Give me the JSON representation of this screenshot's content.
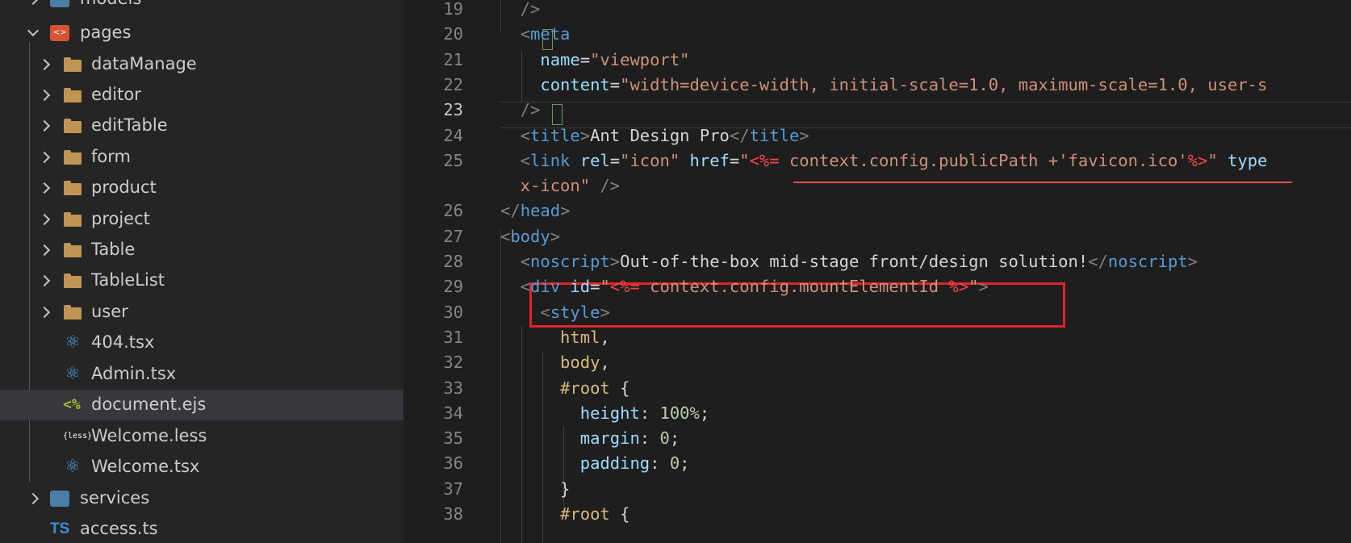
{
  "explorer": {
    "items": [
      {
        "label": "models",
        "kind": "folder-special",
        "icon": "models-folder-icon",
        "expanded": false
      },
      {
        "label": "pages",
        "kind": "folder-special",
        "icon": "pages-folder-icon",
        "expanded": true
      },
      {
        "label": "dataManage",
        "kind": "folder",
        "icon": "folder-icon"
      },
      {
        "label": "editor",
        "kind": "folder",
        "icon": "folder-icon"
      },
      {
        "label": "editTable",
        "kind": "folder",
        "icon": "folder-icon"
      },
      {
        "label": "form",
        "kind": "folder",
        "icon": "folder-icon"
      },
      {
        "label": "product",
        "kind": "folder",
        "icon": "folder-icon"
      },
      {
        "label": "project",
        "kind": "folder",
        "icon": "folder-icon"
      },
      {
        "label": "Table",
        "kind": "folder",
        "icon": "folder-icon"
      },
      {
        "label": "TableList",
        "kind": "folder",
        "icon": "folder-icon"
      },
      {
        "label": "user",
        "kind": "folder",
        "icon": "folder-icon"
      },
      {
        "label": "404.tsx",
        "kind": "file",
        "icon": "react-icon"
      },
      {
        "label": "Admin.tsx",
        "kind": "file",
        "icon": "react-icon"
      },
      {
        "label": "document.ejs",
        "kind": "file",
        "icon": "ejs-icon",
        "selected": true
      },
      {
        "label": "Welcome.less",
        "kind": "file",
        "icon": "less-icon"
      },
      {
        "label": "Welcome.tsx",
        "kind": "file",
        "icon": "react-icon"
      },
      {
        "label": "services",
        "kind": "folder-special",
        "icon": "services-folder-icon",
        "expanded": false
      },
      {
        "label": "access.ts",
        "kind": "file",
        "icon": "ts-icon"
      }
    ],
    "icon_glyphs": {
      "react": "⚛",
      "ejs": "<%",
      "less": "{less}",
      "ts": "TS",
      "pages": "<>"
    }
  },
  "editor": {
    "active_line": "23",
    "lines": [
      {
        "n": "19",
        "parts": [
          [
            "t-br",
            "  />"
          ]
        ]
      },
      {
        "n": "20",
        "parts": [
          [
            "t-br",
            "  <"
          ],
          [
            "t-tag",
            "meta"
          ]
        ]
      },
      {
        "n": "21",
        "parts": [
          [
            "t-attr",
            "    name"
          ],
          [
            "t-txt",
            "="
          ],
          [
            "t-str",
            "\"viewport\""
          ]
        ]
      },
      {
        "n": "22",
        "parts": [
          [
            "t-attr",
            "    content"
          ],
          [
            "t-txt",
            "="
          ],
          [
            "t-str",
            "\"width=device-width, initial-scale=1.0, maximum-scale=1.0, user-s"
          ]
        ]
      },
      {
        "n": "23",
        "parts": [
          [
            "t-br",
            "  />"
          ]
        ]
      },
      {
        "n": "24",
        "parts": [
          [
            "t-br",
            "  <"
          ],
          [
            "t-tag",
            "title"
          ],
          [
            "t-br",
            ">"
          ],
          [
            "t-txt",
            "Ant Design Pro"
          ],
          [
            "t-br",
            "</"
          ],
          [
            "t-tag",
            "title"
          ],
          [
            "t-br",
            ">"
          ]
        ]
      },
      {
        "n": "25",
        "parts": [
          [
            "t-br",
            "  <"
          ],
          [
            "t-tag",
            "link"
          ],
          [
            "t-attr",
            " rel"
          ],
          [
            "t-txt",
            "="
          ],
          [
            "t-str",
            "\"icon\""
          ],
          [
            "t-attr",
            " href"
          ],
          [
            "t-txt",
            "="
          ],
          [
            "t-str",
            "\""
          ],
          [
            "t-ejs",
            "<%="
          ],
          [
            "t-str",
            " context.config.publicPath +'favicon.ico'"
          ],
          [
            "t-ejs",
            "%>"
          ],
          [
            "t-str",
            "\""
          ],
          [
            "t-attr",
            " type"
          ]
        ]
      },
      {
        "n": "",
        "parts": [
          [
            "t-str",
            "  x-icon\""
          ],
          [
            "t-br",
            " />"
          ]
        ]
      },
      {
        "n": "26",
        "parts": [
          [
            "t-br",
            "</"
          ],
          [
            "t-tag",
            "head"
          ],
          [
            "t-br",
            ">"
          ]
        ]
      },
      {
        "n": "27",
        "parts": [
          [
            "t-br",
            "<"
          ],
          [
            "t-tag",
            "body"
          ],
          [
            "t-br",
            ">"
          ]
        ]
      },
      {
        "n": "28",
        "parts": [
          [
            "t-br",
            "  <"
          ],
          [
            "t-tag",
            "noscript"
          ],
          [
            "t-br",
            ">"
          ],
          [
            "t-txt",
            "Out-of-the-box mid-stage front/design solution!"
          ],
          [
            "t-br",
            "</"
          ],
          [
            "t-tag",
            "noscript"
          ],
          [
            "t-br",
            ">"
          ]
        ]
      },
      {
        "n": "29",
        "parts": [
          [
            "t-br",
            "  <"
          ],
          [
            "t-tag",
            "div"
          ],
          [
            "t-attr",
            " id"
          ],
          [
            "t-txt",
            "="
          ],
          [
            "t-str",
            "\""
          ],
          [
            "t-ejs",
            "<%="
          ],
          [
            "t-str",
            " context.config.mountElementId "
          ],
          [
            "t-ejs",
            "%>"
          ],
          [
            "t-str",
            "\""
          ],
          [
            "t-br",
            ">"
          ]
        ]
      },
      {
        "n": "30",
        "parts": [
          [
            "t-br",
            "    <"
          ],
          [
            "t-tag",
            "style"
          ],
          [
            "t-br",
            ">"
          ]
        ]
      },
      {
        "n": "31",
        "parts": [
          [
            "t-sel",
            "      html"
          ],
          [
            "t-txt",
            ","
          ]
        ]
      },
      {
        "n": "32",
        "parts": [
          [
            "t-sel",
            "      body"
          ],
          [
            "t-txt",
            ","
          ]
        ]
      },
      {
        "n": "33",
        "parts": [
          [
            "t-sel",
            "      #root"
          ],
          [
            "t-txt",
            " {"
          ]
        ]
      },
      {
        "n": "34",
        "parts": [
          [
            "t-prop",
            "        height"
          ],
          [
            "t-txt",
            ": "
          ],
          [
            "t-num",
            "100%"
          ],
          [
            "t-txt",
            ";"
          ]
        ]
      },
      {
        "n": "35",
        "parts": [
          [
            "t-prop",
            "        margin"
          ],
          [
            "t-txt",
            ": "
          ],
          [
            "t-num",
            "0"
          ],
          [
            "t-txt",
            ";"
          ]
        ]
      },
      {
        "n": "36",
        "parts": [
          [
            "t-prop",
            "        padding"
          ],
          [
            "t-txt",
            ": "
          ],
          [
            "t-num",
            "0"
          ],
          [
            "t-txt",
            ";"
          ]
        ]
      },
      {
        "n": "37",
        "parts": [
          [
            "t-txt",
            "      }"
          ]
        ]
      },
      {
        "n": "38",
        "parts": [
          [
            "t-sel",
            "      #root"
          ],
          [
            "t-txt",
            " {"
          ]
        ]
      }
    ]
  },
  "colors": {
    "highlight_box": "#e0242b",
    "selected_row": "#37373d"
  }
}
